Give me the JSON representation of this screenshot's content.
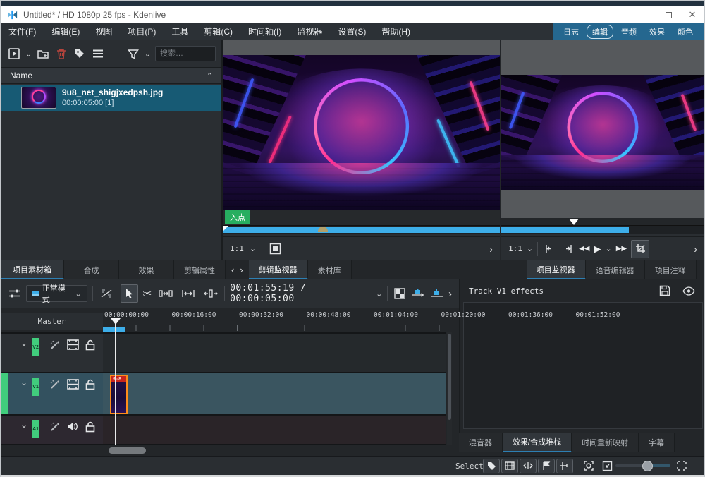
{
  "window": {
    "title": "Untitled* / HD 1080p 25 fps - Kdenlive"
  },
  "menu": {
    "items": [
      "文件(F)",
      "编辑(E)",
      "视图",
      "项目(P)",
      "工具",
      "剪辑(C)",
      "时间轴(I)",
      "监视器",
      "设置(S)",
      "帮助(H)"
    ]
  },
  "layout_switcher": {
    "items": [
      "日志",
      "编辑",
      "音频",
      "效果",
      "颜色"
    ],
    "active": "编辑"
  },
  "bin": {
    "search_placeholder": "搜索…",
    "name_header": "Name",
    "clip_name": "9u8_net_shigjxedpsh.jpg",
    "clip_duration": "00:00:05:00 [1]"
  },
  "panel_tabs": {
    "left": [
      "项目素材箱",
      "合成",
      "效果",
      "剪辑属性"
    ],
    "left_active": "项目素材箱",
    "monitor": [
      "剪辑监视器",
      "素材库"
    ],
    "monitor_active": "剪辑监视器",
    "right": [
      "项目监视器",
      "语音编辑器",
      "项目注释"
    ],
    "right_active": "项目监视器",
    "bottom_right": [
      "混音器",
      "效果/合成堆栈",
      "时间重新映射",
      "字幕"
    ],
    "bottom_right_active": "效果/合成堆栈"
  },
  "clip_monitor": {
    "in_point_label": "入点",
    "zoom_level": "1:1"
  },
  "project_monitor": {
    "zoom_level": "1:1"
  },
  "timeline_toolbar": {
    "mode": "正常模式",
    "current_position": "00:01:55:19",
    "total_duration": "00:00:05:00",
    "separator": "/"
  },
  "timeline": {
    "master_label": "Master",
    "ruler_labels": [
      "00:00:00:00",
      "00:00:16:00",
      "00:00:32:00",
      "00:00:48:00",
      "00:01:04:00",
      "00:01:20:00",
      "00:01:36:00",
      "00:01:52:00"
    ],
    "tracks": [
      {
        "id": "V2"
      },
      {
        "id": "V1"
      },
      {
        "id": "A1"
      }
    ],
    "clip_label": "9u8"
  },
  "effects_panel": {
    "title": "Track V1 effects"
  },
  "status_bar": {
    "select_label": "Select"
  },
  "glyphs": {
    "chevron_down": "⌄",
    "chevron_up": "⌃",
    "arrow_prev": "‹",
    "arrow_next": "›",
    "more": "›",
    "scissors": "✂",
    "rewind": "◀◀",
    "play": "▶",
    "forward": "▶▶",
    "minimize": "–",
    "close": "✕"
  }
}
